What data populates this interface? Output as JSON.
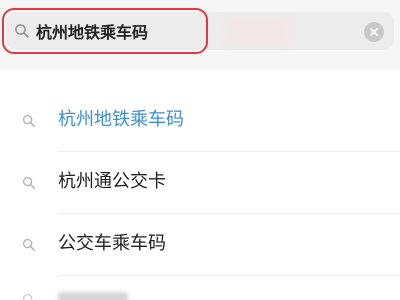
{
  "search": {
    "value": "杭州地铁乘车码",
    "clear_icon": "clear-icon",
    "search_icon": "search-icon"
  },
  "suggestions": [
    {
      "label": "杭州地铁乘车码",
      "icon": "search-icon",
      "highlighted": true
    },
    {
      "label": "杭州通公交卡",
      "icon": "search-icon",
      "highlighted": false
    },
    {
      "label": "公交车乘车码",
      "icon": "search-icon",
      "highlighted": false
    }
  ],
  "colors": {
    "highlight_text": "#3a8fd6",
    "normal_text": "#1f1f1f",
    "annotation_ring": "#e0393e",
    "search_box_bg": "#ececec"
  }
}
